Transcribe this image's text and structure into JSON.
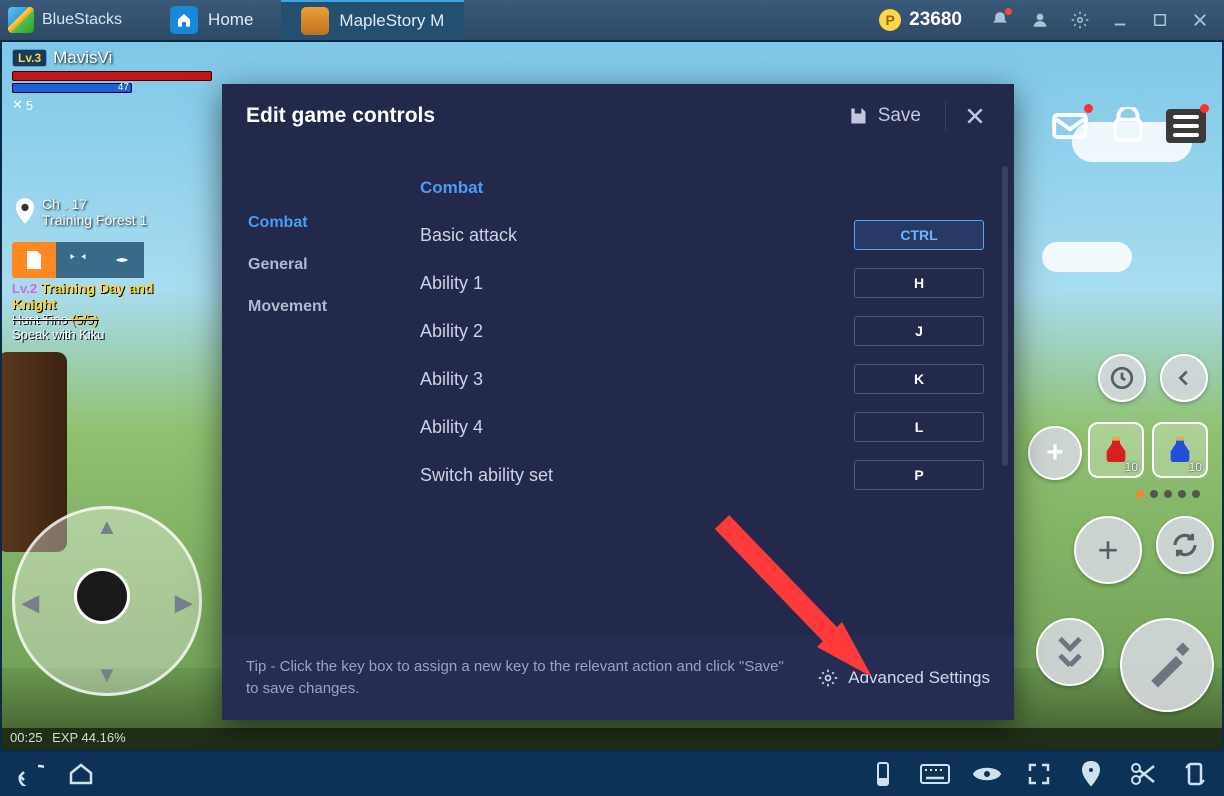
{
  "titlebar": {
    "brand": "BlueStacks",
    "tabs": [
      {
        "label": "Home"
      },
      {
        "label": "MapleStory M"
      }
    ],
    "coins": "23680"
  },
  "player": {
    "level": "Lv.3",
    "name": "MavisVi",
    "mp": "47",
    "swords": "5"
  },
  "location": {
    "line1": "Ch . 17",
    "line2": "Training Forest 1"
  },
  "quest": {
    "level": "Lv.2",
    "title": "Training Day and Knight",
    "line1a": "Hunt Tino ",
    "line1b": "(5/5)",
    "line2": "Speak with Kiku"
  },
  "potions": {
    "red": "10",
    "blue": "10"
  },
  "exp": {
    "time": "00:25",
    "text": "EXP 44.16%"
  },
  "modal": {
    "title": "Edit game controls",
    "save": "Save",
    "sidebar": [
      "Combat",
      "General",
      "Movement"
    ],
    "section": "Combat",
    "rows": [
      {
        "label": "Basic attack",
        "key": "CTRL",
        "selected": true
      },
      {
        "label": "Ability 1",
        "key": "H",
        "selected": false
      },
      {
        "label": "Ability 2",
        "key": "J",
        "selected": false
      },
      {
        "label": "Ability 3",
        "key": "K",
        "selected": false
      },
      {
        "label": "Ability 4",
        "key": "L",
        "selected": false
      },
      {
        "label": "Switch ability set",
        "key": "P",
        "selected": false
      }
    ],
    "tip": "Tip - Click the key box to assign a new key to the relevant action and click \"Save\" to save changes.",
    "advanced": "Advanced Settings"
  }
}
